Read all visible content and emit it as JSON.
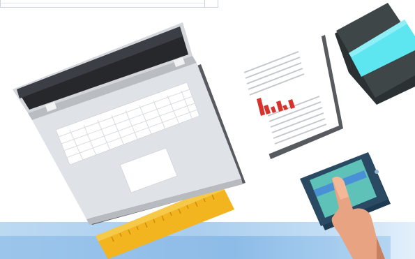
{
  "scene": {
    "objects": [
      {
        "name": "laptop",
        "icon": "laptop-icon"
      },
      {
        "name": "report-document",
        "icon": "document-icon"
      },
      {
        "name": "notebook",
        "icon": "notebook-icon"
      },
      {
        "name": "smartphone-with-hand",
        "icon": "phone-icon"
      },
      {
        "name": "ruler",
        "icon": "ruler-icon"
      }
    ]
  },
  "colors": {
    "background": "#ffffff",
    "floor": "#a9cdee",
    "laptop_body": "#dcdfe3",
    "laptop_screen": "#2b2d31",
    "document_chart": "#d7322b",
    "notebook_cover": "#3e4648",
    "notebook_band": "#5de6f0",
    "phone_body": "#2a4a63",
    "phone_screen": "#5fc2b8",
    "ruler": "#f2b51f",
    "hand": "#e8a382"
  }
}
